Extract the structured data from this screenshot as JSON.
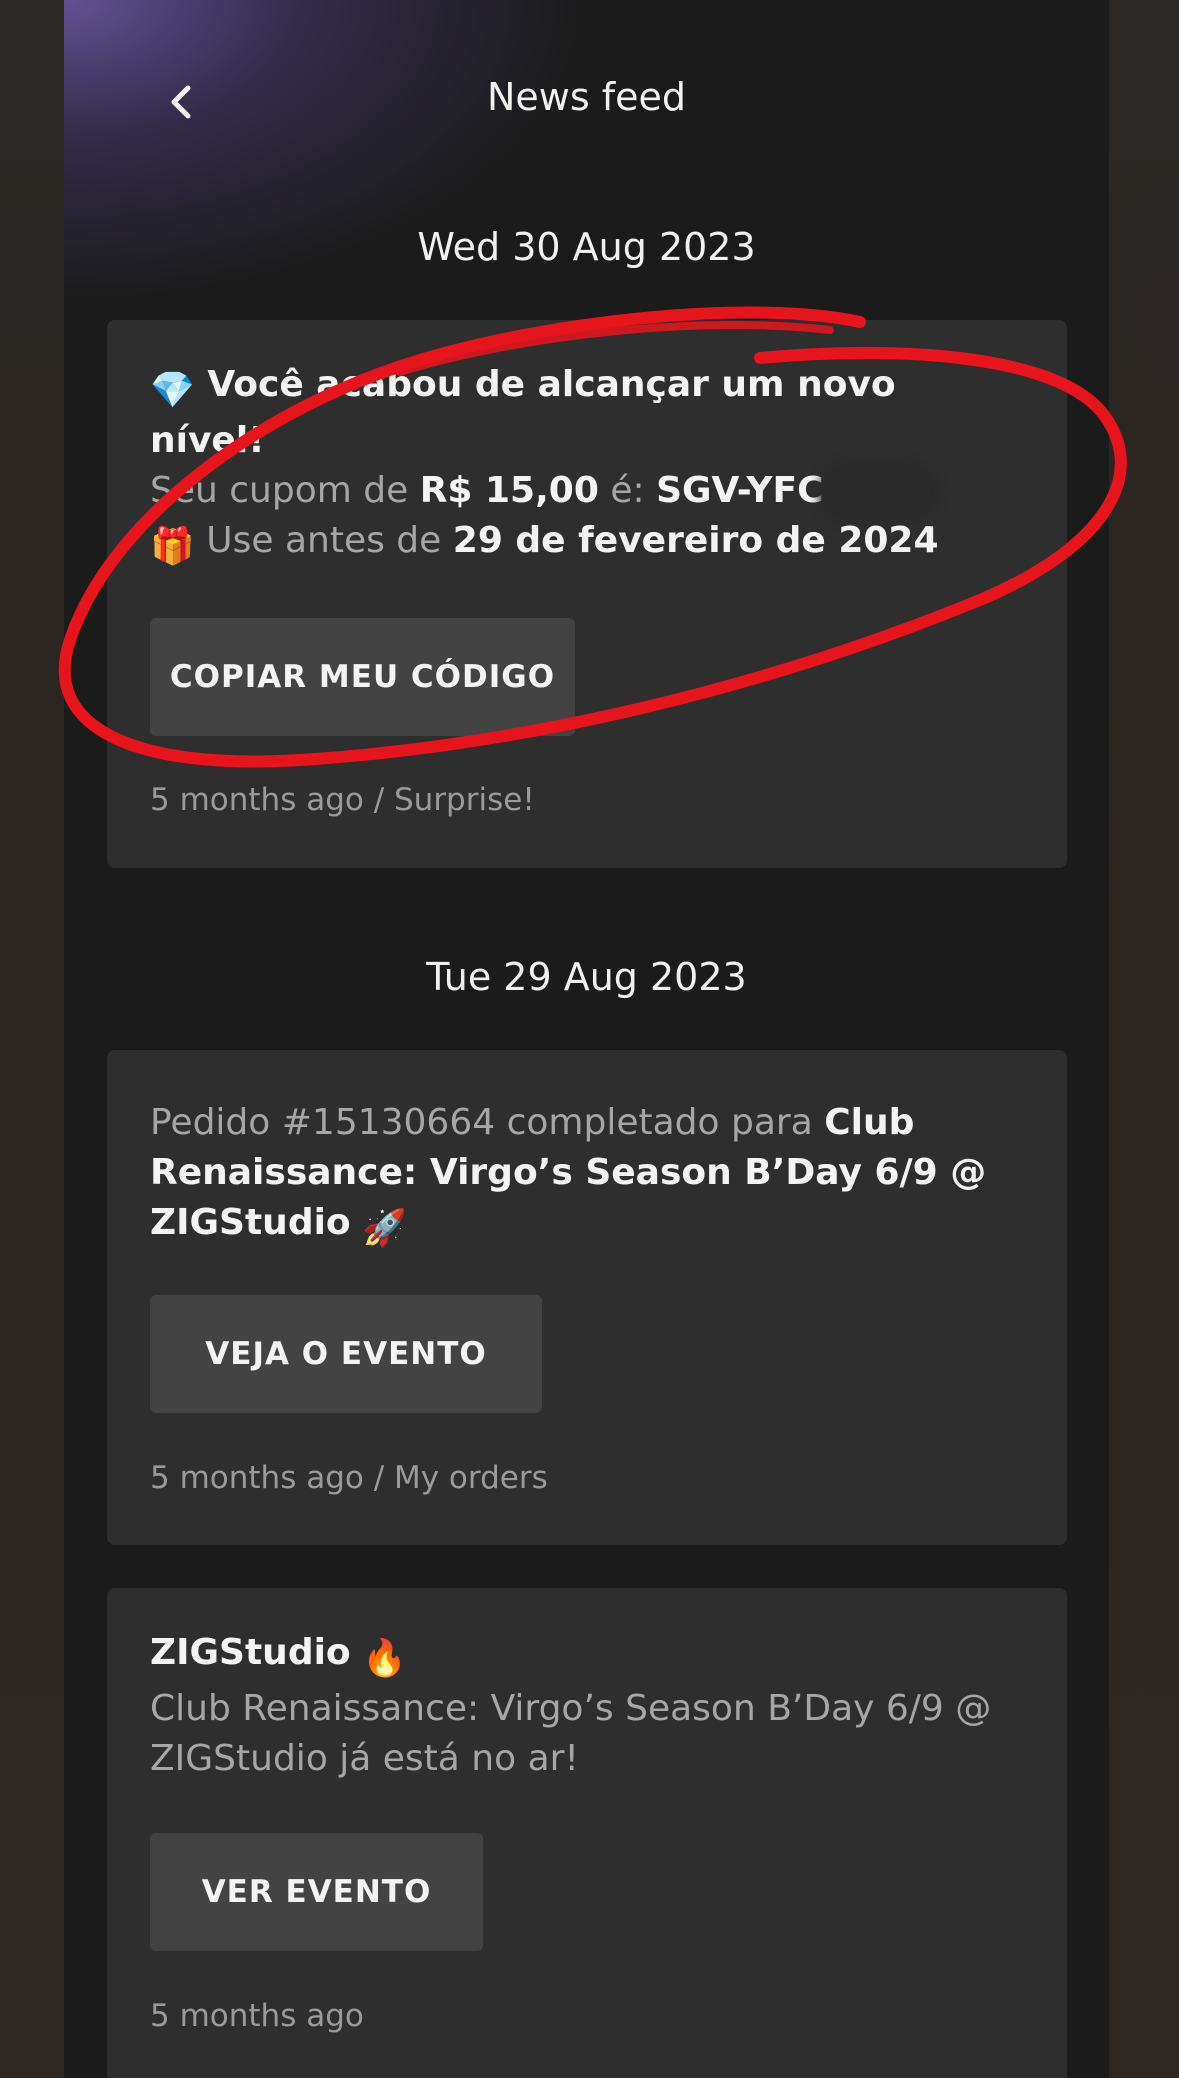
{
  "header": {
    "title": "News feed",
    "back_icon": "chevron-left-icon"
  },
  "sections": [
    {
      "date": "Wed 30 Aug 2023",
      "card": {
        "line1_emoji": "💎",
        "line1": "Você acabou de alcançar um novo nível!",
        "coupon_prefix": "Seu cupom de ",
        "coupon_amount": "R$ 15,00",
        "coupon_mid": " é: ",
        "coupon_code": "SGV-YFC",
        "use_emoji": "🎁",
        "use_prefix": " Use antes de ",
        "use_date": "29 de fevereiro de 2024",
        "button": "COPIAR MEU CÓDIGO",
        "meta": "5 months ago / Surprise!"
      }
    },
    {
      "date": "Tue 29 Aug 2023",
      "card": {
        "prefix": "Pedido #15130664 completado para ",
        "event": "Club Renaissance: Virgo’s Season B’Day 6/9 @ ZIGStudio",
        "emoji": "🚀",
        "button": "VEJA O EVENTO",
        "meta": "5 months ago / My orders"
      }
    },
    {
      "card": {
        "title": "ZIGStudio",
        "title_emoji": "🔥",
        "body": "Club Renaissance: Virgo’s Season B’Day 6/9 @ ZIGStudio já está no ar!",
        "button": "VER EVENTO",
        "meta": "5 months ago"
      }
    }
  ],
  "colors": {
    "annotation": "#e8141c",
    "card_bg": "#2e2e2e",
    "button_bg": "#434343",
    "screen_bg": "#1b1b1b"
  }
}
